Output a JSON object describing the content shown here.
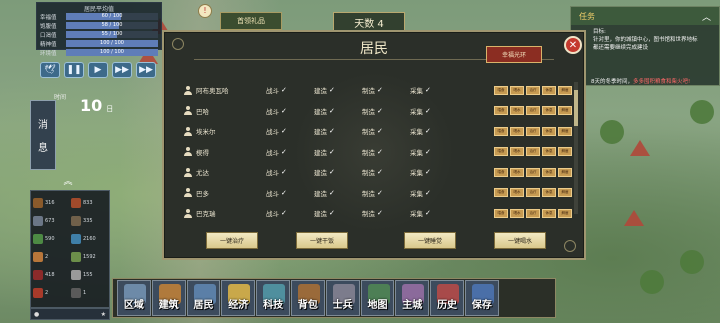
{
  "stats": {
    "title": "居民平均值",
    "rows": [
      {
        "label": "幸福值",
        "value": "60 / 100",
        "fill": 0.6,
        "color": "#5f7db8"
      },
      {
        "label": "饱腹值",
        "value": "58 / 100",
        "fill": 0.58,
        "color": "#5f7db8"
      },
      {
        "label": "口渴值",
        "value": "55 / 100",
        "fill": 0.55,
        "color": "#5f7db8"
      },
      {
        "label": "精神值",
        "value": "100 / 100",
        "fill": 1.0,
        "color": "#5f7db8"
      },
      {
        "label": "环境值",
        "value": "100 / 100",
        "fill": 1.0,
        "color": "#5f7db8"
      }
    ]
  },
  "controls": {
    "icons": [
      "bird-icon",
      "pause-icon",
      "play-icon",
      "fast-forward-icon",
      "fastest-forward-icon"
    ],
    "glyphs": [
      "🕊",
      "❚❚",
      "▶",
      "▶▶",
      "▶▶"
    ]
  },
  "time": {
    "caption": "时间",
    "day": "10",
    "unit": "日"
  },
  "message_tab": {
    "line1": "消",
    "line2": "息"
  },
  "resources": [
    {
      "value": "316",
      "color": "#8a5a2b",
      "icon": "wood-icon"
    },
    {
      "value": "833",
      "color": "#a14a2b",
      "icon": "meat-icon"
    },
    {
      "value": "673",
      "color": "#6b7686",
      "icon": "stone-icon"
    },
    {
      "value": "335",
      "color": "#70604a",
      "icon": "leather-icon"
    },
    {
      "value": "590",
      "color": "#4d8a44",
      "icon": "herb-icon"
    },
    {
      "value": "2160",
      "color": "#3f7fa8",
      "icon": "water-icon"
    },
    {
      "value": "2",
      "color": "#b8763a",
      "icon": "bread-icon"
    },
    {
      "value": "1592",
      "color": "#6c8f4a",
      "icon": "vegetable-icon"
    },
    {
      "value": "418",
      "color": "#8b2a2a",
      "icon": "tool-icon"
    },
    {
      "value": "155",
      "color": "#9a9a9a",
      "icon": "iron-icon"
    },
    {
      "value": "2",
      "color": "#a83a2a",
      "icon": "weapon-icon"
    },
    {
      "value": "1",
      "color": "#5a5a5a",
      "icon": "coal-icon"
    }
  ],
  "resources_footer": {
    "left": "●",
    "right": "★"
  },
  "top_bar": {
    "left_button": "首领礼品",
    "day_banner": "天数 4",
    "notice": "!"
  },
  "quest": {
    "title": "任务",
    "collapse": "︿",
    "body": "目标:\n针对里，你的城镇中心，图书馆和世界地标都还需要继续完成建设",
    "tip_prefix": "8天的冬季时间，",
    "tip_highlight": "多多囤积粮食和柴火吧!"
  },
  "dialog": {
    "title": "居民",
    "rename_button": "幸福光环",
    "close": "✕",
    "jobs": [
      "战斗",
      "建造",
      "制造",
      "采集"
    ],
    "actions": [
      "喂食",
      "喝水",
      "治疗",
      "休息",
      "解雇"
    ],
    "residents": [
      {
        "name": "阿布奥瓦哈"
      },
      {
        "name": "巴哈"
      },
      {
        "name": "埃米尔"
      },
      {
        "name": "楔得"
      },
      {
        "name": "尤达"
      },
      {
        "name": "巴多"
      },
      {
        "name": "巴克瑞"
      }
    ],
    "bottom_buttons": [
      "一键治疗",
      "一键干饭",
      "一键睡觉",
      "一键喝水"
    ]
  },
  "nav": [
    {
      "label": "区域",
      "color": "#6d8aa8",
      "icon": "region-icon"
    },
    {
      "label": "建筑",
      "color": "#b07a3c",
      "icon": "building-icon"
    },
    {
      "label": "居民",
      "color": "#5b7fa7",
      "icon": "residents-icon"
    },
    {
      "label": "经济",
      "color": "#c9a84a",
      "icon": "economy-icon"
    },
    {
      "label": "科技",
      "color": "#4f8f9e",
      "icon": "technology-icon"
    },
    {
      "label": "背包",
      "color": "#9a6a3a",
      "icon": "backpack-icon"
    },
    {
      "label": "士兵",
      "color": "#7c7c8c",
      "icon": "soldier-icon"
    },
    {
      "label": "地图",
      "color": "#4d7f55",
      "icon": "map-icon"
    },
    {
      "label": "主城",
      "color": "#8b6a9b",
      "icon": "main-city-icon"
    },
    {
      "label": "历史",
      "color": "#a84a4a",
      "icon": "history-icon"
    },
    {
      "label": "保存",
      "color": "#4a6fa8",
      "icon": "save-icon"
    }
  ]
}
